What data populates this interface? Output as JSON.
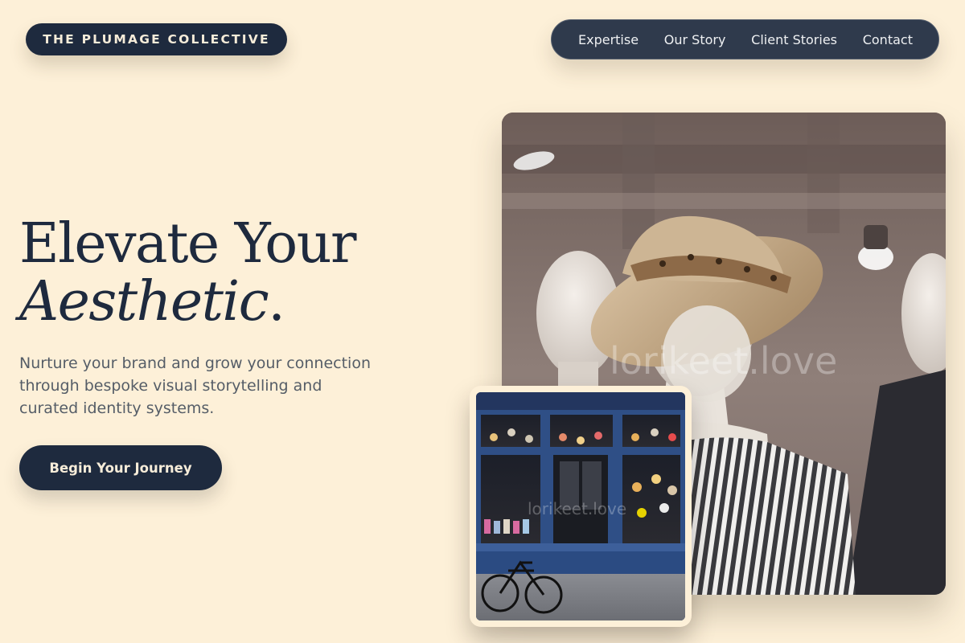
{
  "brand": {
    "name": "THE PLUMAGE COLLECTIVE"
  },
  "nav": {
    "items": [
      {
        "label": "Expertise"
      },
      {
        "label": "Our Story"
      },
      {
        "label": "Client Stories"
      },
      {
        "label": "Contact"
      }
    ]
  },
  "hero": {
    "title_line1": "Elevate Your",
    "title_line2": "Aesthetic",
    "title_period": ".",
    "subtitle": "Nurture your brand and grow your connection through bespoke visual storytelling and curated identity systems.",
    "cta_label": "Begin Your Journey"
  },
  "images": {
    "main": {
      "description": "mannequins-with-hats-in-boutique",
      "watermark": "lorikeet.love"
    },
    "inset": {
      "description": "blue-storefront-with-bicycle",
      "watermark": "lorikeet.love"
    }
  },
  "colors": {
    "background": "#FDF0D8",
    "navy": "#1E2A3E",
    "nav_bg": "#2F3A4C",
    "cream_text": "#F6ECD9",
    "body_text": "#555D67"
  }
}
